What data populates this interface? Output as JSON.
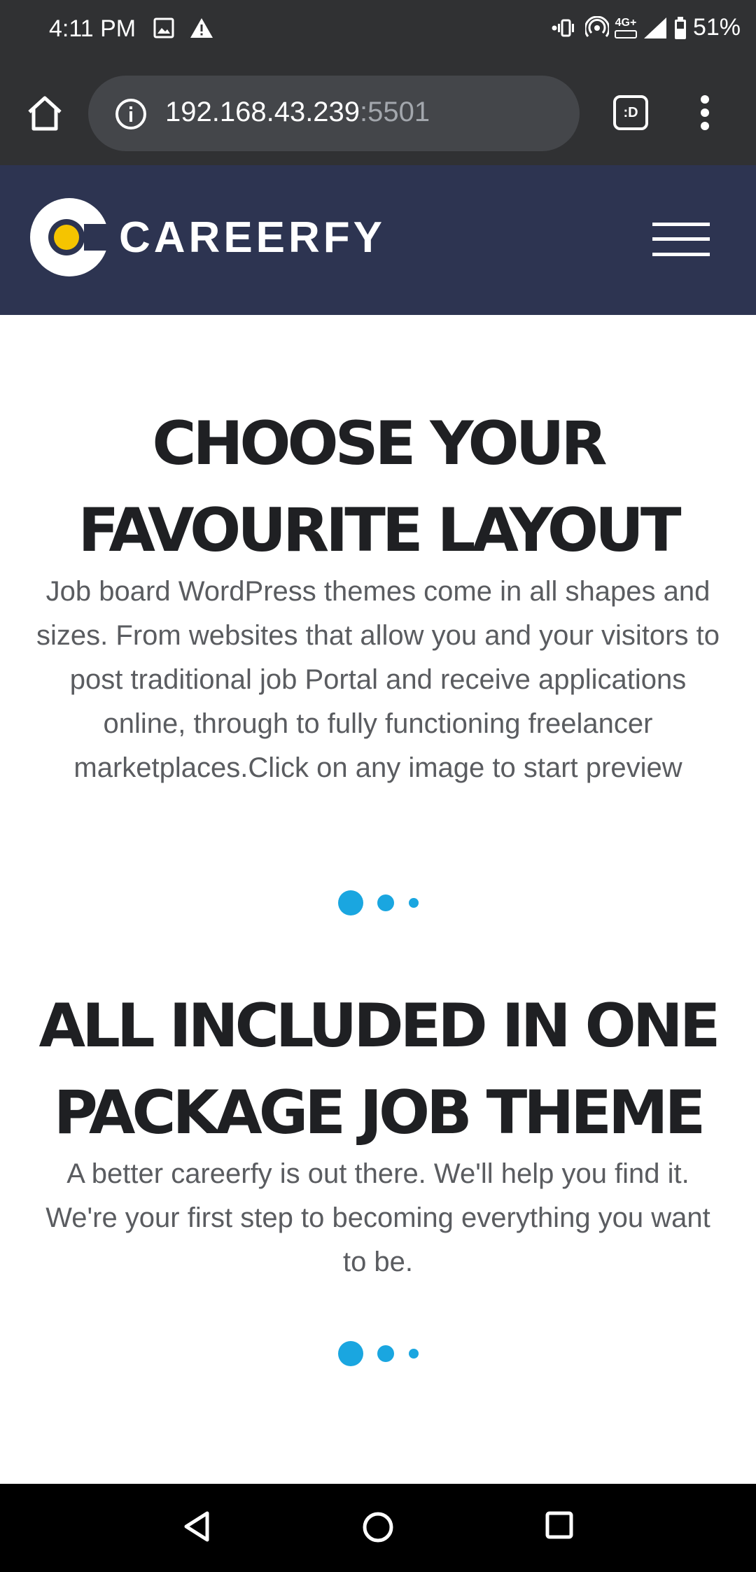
{
  "status_bar": {
    "time": "4:11 PM",
    "network": "4G+",
    "battery": "51%"
  },
  "browser": {
    "url_host": "192.168.43.239",
    "url_port": ":5501",
    "tabs_label": ":D"
  },
  "site": {
    "brand": "CAREERFY",
    "brand_colors": {
      "navy": "#2d3451",
      "yellow": "#f5c400",
      "accent": "#1aa6e0"
    }
  },
  "sections": [
    {
      "title_line1": "CHOOSE YOUR",
      "title_line2": "FAVOURITE LAYOUT",
      "text": "Job board WordPress themes come in all shapes and sizes. From websites that allow you and your visitors to post traditional job Portal and receive applications online, through to fully functioning freelancer marketplaces.Click on any image to start preview"
    },
    {
      "title_line1": "ALL INCLUDED IN ONE",
      "title_line2": "PACKAGE JOB THEME",
      "text": "A better careerfy is out there. We'll help you find it. We're your first step to becoming everything you want to be."
    }
  ]
}
